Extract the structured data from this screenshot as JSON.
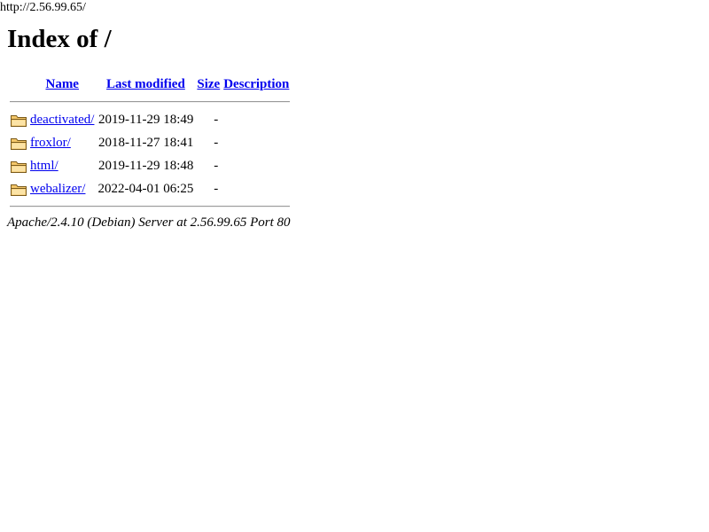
{
  "browser": {
    "url": "http://2.56.99.65/"
  },
  "page": {
    "title": "Index of /"
  },
  "table": {
    "headers": {
      "name": "Name",
      "last_modified": "Last modified",
      "size": "Size",
      "description": "Description"
    },
    "rows": [
      {
        "icon": "folder-icon",
        "name": "deactivated/",
        "date": "2019-11-29 18:49",
        "size": "-",
        "description": ""
      },
      {
        "icon": "folder-icon",
        "name": "froxlor/",
        "date": "2018-11-27 18:41",
        "size": "-",
        "description": ""
      },
      {
        "icon": "folder-icon",
        "name": "html/",
        "date": "2019-11-29 18:48",
        "size": "-",
        "description": ""
      },
      {
        "icon": "folder-icon",
        "name": "webalizer/",
        "date": "2022-04-01 06:25",
        "size": "-",
        "description": ""
      }
    ]
  },
  "footer": {
    "server_signature": "Apache/2.4.10 (Debian) Server at 2.56.99.65 Port 80"
  },
  "colors": {
    "link": "#0000ee",
    "folder_fill": "#f4c76a",
    "folder_stroke": "#7a5a1a"
  }
}
